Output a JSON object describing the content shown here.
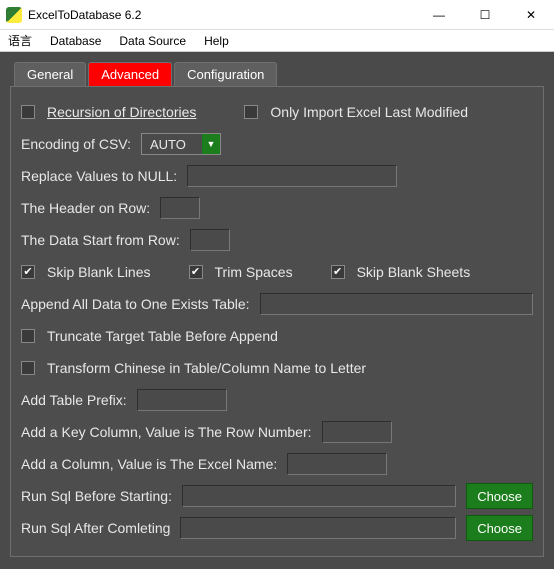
{
  "window": {
    "title": "ExcelToDatabase 6.2"
  },
  "menu": {
    "language": "语言",
    "database": "Database",
    "data_source": "Data Source",
    "help": "Help"
  },
  "tabs": {
    "general": "General",
    "advanced": "Advanced",
    "configuration": "Configuration"
  },
  "labels": {
    "recursion_dirs": "Recursion of Directories",
    "only_last_modified": "Only Import Excel Last Modified",
    "encoding_csv": "Encoding of CSV:",
    "replace_null": "Replace Values to NULL:",
    "header_row": "The Header on Row:",
    "data_start_row": "The Data Start from Row:",
    "skip_blank_lines": "Skip Blank Lines",
    "trim_spaces": "Trim Spaces",
    "skip_blank_sheets": "Skip Blank Sheets",
    "append_table": "Append All Data to One Exists Table:",
    "truncate": "Truncate Target Table Before Append",
    "transform_chinese": "Transform Chinese in Table/Column Name to Letter",
    "table_prefix": "Add Table Prefix:",
    "key_col_rownum": "Add a Key Column, Value is The Row Number:",
    "col_excel_name": "Add a Column, Value is The Excel Name:",
    "sql_before": "Run Sql Before Starting:",
    "sql_after": "Run Sql After Comleting"
  },
  "values": {
    "encoding_selected": "AUTO",
    "replace_null": "",
    "header_row": "",
    "data_start_row": "",
    "append_table": "",
    "table_prefix": "",
    "key_col_rownum": "",
    "col_excel_name": "",
    "sql_before": "",
    "sql_after": ""
  },
  "checks": {
    "recursion_dirs": false,
    "only_last_modified": false,
    "skip_blank_lines": true,
    "trim_spaces": true,
    "skip_blank_sheets": true,
    "truncate": false,
    "transform_chinese": false
  },
  "buttons": {
    "choose": "Choose"
  }
}
